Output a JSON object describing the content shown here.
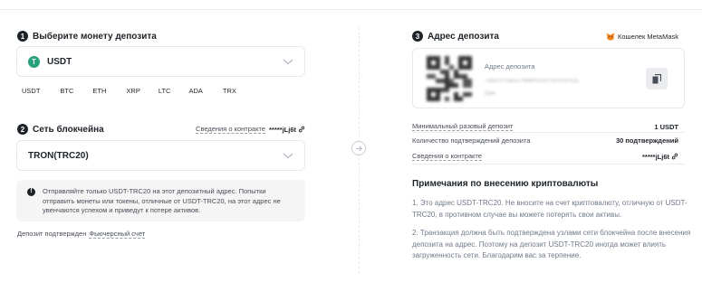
{
  "step1": {
    "number": "1",
    "title": "Выберите монету депозита"
  },
  "coin_select": {
    "icon_letter": "T",
    "value": "USDT"
  },
  "coin_chips": [
    "USDT",
    "BTC",
    "ETH",
    "XRP",
    "LTC",
    "ADA",
    "TRX"
  ],
  "step2": {
    "number": "2",
    "title": "Сеть блокчейна"
  },
  "contract": {
    "label": "Сведения о контракте",
    "address": "*****jLj6t"
  },
  "network_select": {
    "value": "TRON(TRC20)"
  },
  "warning": {
    "icon": "!",
    "text": "Отправляйте только USDT-TRC20 на этот депозитный адрес. Попытки отправить монеты или токены, отличные от USDT-TRC20, на этот адрес не увенчаются успехом и приведут к потере активов."
  },
  "footnote": {
    "text": "Депозит подтвержден",
    "link": "Фьючерсный счет"
  },
  "step3": {
    "number": "3",
    "title": "Адрес депозита"
  },
  "wallet_link": {
    "label": "Кошелек MetaMask",
    "icon": "metamask-fox-icon"
  },
  "address_card": {
    "label": "Адрес депозита",
    "address_line1": "TBkk7P7Nk5X7MMPKcxR7xPkVKrS2L",
    "address_line2": "Dpw"
  },
  "details": [
    {
      "label": "Минимальный разовый депозит",
      "value": "1 USDT",
      "dotted": true
    },
    {
      "label": "Количество подтверждений депозита",
      "value": "30 подтверждений",
      "dotted": false
    },
    {
      "label": "Сведения о контракте",
      "value": "*****jLj6t",
      "dotted": true
    }
  ],
  "notes": {
    "title": "Примечания по внесению криптовалюты",
    "items": [
      "1. Это адрес USDT-TRC20. Не вносите на счет криптовалюту, отличную от USDT-TRC20, в противном случае вы можете потерять свои активы.",
      "2. Транзакция должна быть подтверждена узлами сети блокчейна после внесения депозита на адрес. Поэтому на депозит USDT-TRC20 иногда может влиять загруженность сети. Благодарим вас за терпение."
    ]
  },
  "colors": {
    "tether_green": "#26a17b",
    "text_primary": "#1e2329",
    "text_secondary": "#707a8a",
    "border": "#e6e8ea"
  }
}
